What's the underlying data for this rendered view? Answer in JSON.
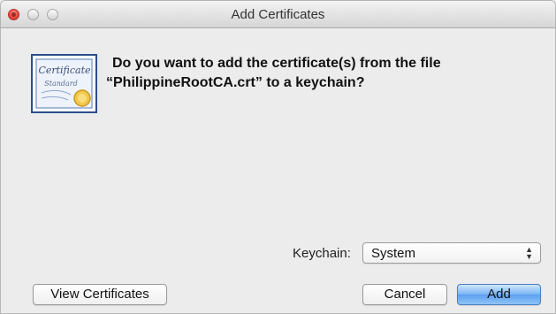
{
  "window": {
    "title": "Add Certificates"
  },
  "icon": {
    "name": "certificate-icon",
    "lines": [
      "Certificate",
      "Standard"
    ]
  },
  "message": {
    "line1": "Do you want to add the certificate(s) from the file",
    "line2": "“PhilippineRootCA.crt” to a keychain?"
  },
  "keychain": {
    "label": "Keychain:",
    "selected": "System"
  },
  "buttons": {
    "view_certificates": "View Certificates",
    "cancel": "Cancel",
    "add": "Add"
  },
  "colors": {
    "close_button": "#e8473d",
    "default_button": "#5d9ff0"
  }
}
